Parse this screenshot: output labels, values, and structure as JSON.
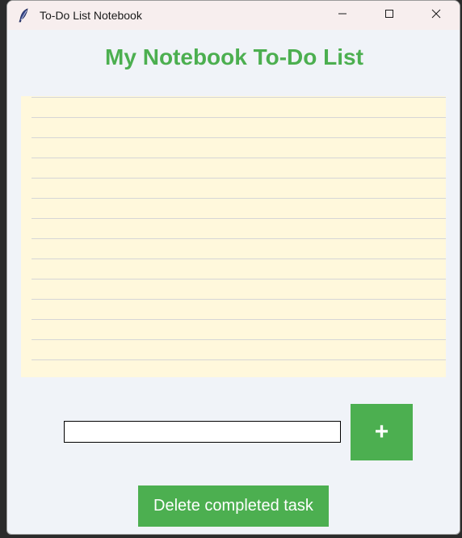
{
  "window": {
    "title": "To-Do List Notebook",
    "app_icon": "feather-icon",
    "controls": {
      "minimize_icon": "minimize-icon",
      "maximize_icon": "maximize-icon",
      "close_icon": "close-icon"
    }
  },
  "main": {
    "heading": "My Notebook To-Do List",
    "notebook": {
      "background_color": "#fff8dc",
      "line_color": "#d6d6d6",
      "tasks": []
    },
    "task_input": {
      "value": "",
      "placeholder": ""
    },
    "add_button": {
      "label": "+"
    },
    "delete_button": {
      "label": "Delete completed task"
    }
  },
  "colors": {
    "accent": "#4caf50",
    "window_background": "#f0f3f8",
    "titlebar_background": "#f7eeee"
  }
}
